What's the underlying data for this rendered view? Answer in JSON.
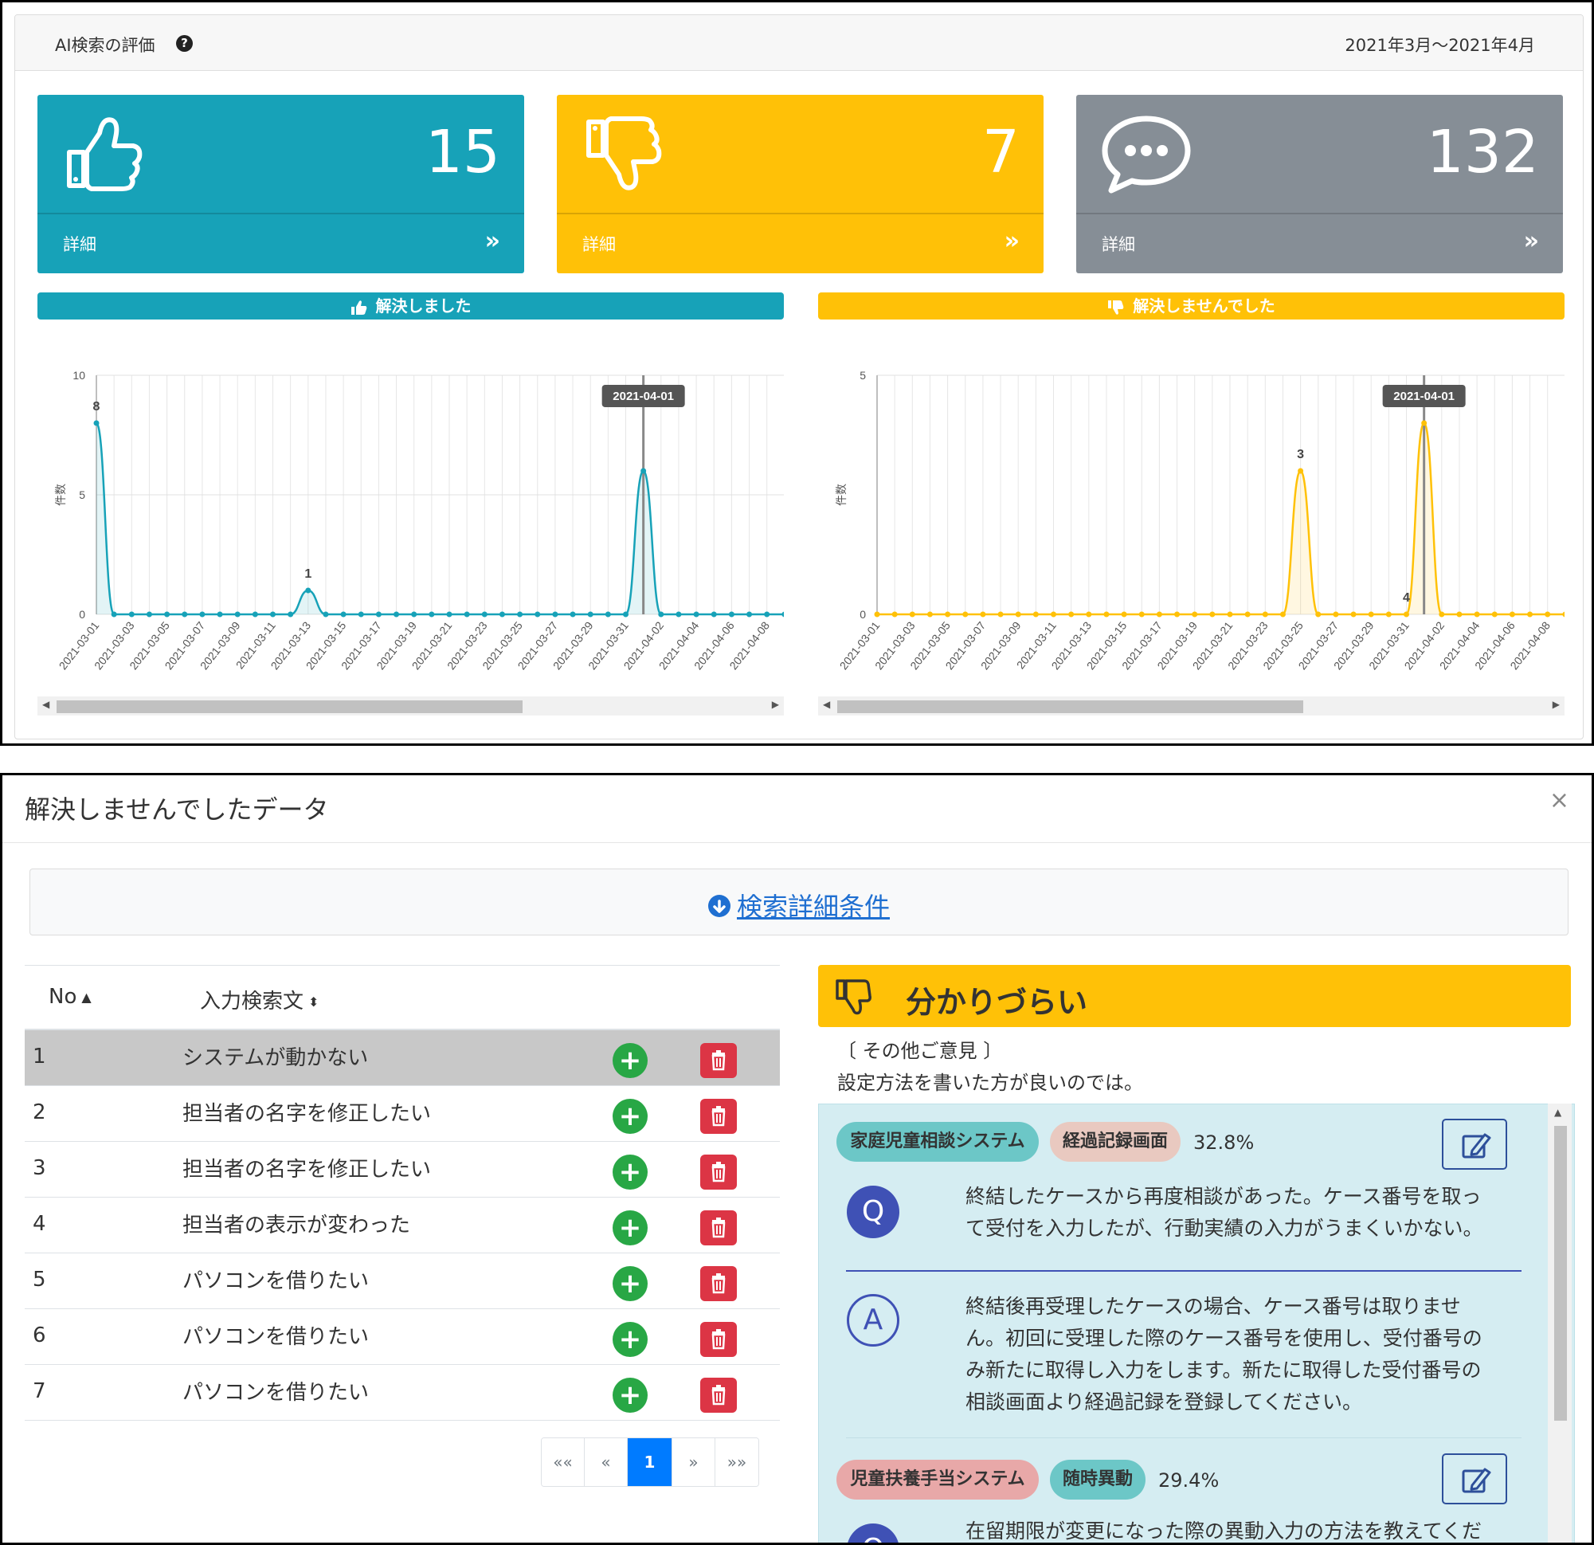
{
  "panel": {
    "title": "AI検索の評価",
    "date_range": "2021年3月～2021年4月"
  },
  "cards": [
    {
      "value": "15",
      "link": "詳細",
      "icon": "thumbs-up-icon",
      "color": "#17a2b8"
    },
    {
      "value": "7",
      "link": "詳細",
      "icon": "thumbs-down-icon",
      "color": "#ffc107"
    },
    {
      "value": "132",
      "link": "詳細",
      "icon": "comment-dots-icon",
      "color": "#868e96"
    }
  ],
  "charts": {
    "solved_label": "解決しました",
    "unsolved_label": "解決しませんでした",
    "ylabel": "件数",
    "tooltip": "2021-04-01"
  },
  "chart_data": [
    {
      "type": "area",
      "title": "解決しました",
      "ylabel": "件数",
      "ylim": [
        0,
        10
      ],
      "yticks": [
        0,
        5,
        10
      ],
      "color": "#17a2b8",
      "x": [
        "2021-03-01",
        "2021-03-02",
        "2021-03-03",
        "2021-03-04",
        "2021-03-05",
        "2021-03-06",
        "2021-03-07",
        "2021-03-08",
        "2021-03-09",
        "2021-03-10",
        "2021-03-11",
        "2021-03-12",
        "2021-03-13",
        "2021-03-14",
        "2021-03-15",
        "2021-03-16",
        "2021-03-17",
        "2021-03-18",
        "2021-03-19",
        "2021-03-20",
        "2021-03-21",
        "2021-03-22",
        "2021-03-23",
        "2021-03-24",
        "2021-03-25",
        "2021-03-26",
        "2021-03-27",
        "2021-03-28",
        "2021-03-29",
        "2021-03-30",
        "2021-03-31",
        "2021-04-01",
        "2021-04-02",
        "2021-04-03",
        "2021-04-04",
        "2021-04-05",
        "2021-04-06",
        "2021-04-07",
        "2021-04-08",
        "2021-04-09"
      ],
      "values": [
        8,
        0,
        0,
        0,
        0,
        0,
        0,
        0,
        0,
        0,
        0,
        0,
        1,
        0,
        0,
        0,
        0,
        0,
        0,
        0,
        0,
        0,
        0,
        0,
        0,
        0,
        0,
        0,
        0,
        0,
        0,
        6,
        0,
        0,
        0,
        0,
        0,
        0,
        0,
        0
      ],
      "labeled_points": [
        {
          "x": "2021-03-01",
          "label": "8"
        },
        {
          "x": "2021-03-13",
          "label": "1"
        }
      ],
      "highlight_x": "2021-04-01"
    },
    {
      "type": "area",
      "title": "解決しませんでした",
      "ylabel": "件数",
      "ylim": [
        0,
        5
      ],
      "yticks": [
        0,
        5
      ],
      "color": "#ffc107",
      "x": [
        "2021-03-01",
        "2021-03-02",
        "2021-03-03",
        "2021-03-04",
        "2021-03-05",
        "2021-03-06",
        "2021-03-07",
        "2021-03-08",
        "2021-03-09",
        "2021-03-10",
        "2021-03-11",
        "2021-03-12",
        "2021-03-13",
        "2021-03-14",
        "2021-03-15",
        "2021-03-16",
        "2021-03-17",
        "2021-03-18",
        "2021-03-19",
        "2021-03-20",
        "2021-03-21",
        "2021-03-22",
        "2021-03-23",
        "2021-03-24",
        "2021-03-25",
        "2021-03-26",
        "2021-03-27",
        "2021-03-28",
        "2021-03-29",
        "2021-03-30",
        "2021-03-31",
        "2021-04-01",
        "2021-04-02",
        "2021-04-03",
        "2021-04-04",
        "2021-04-05",
        "2021-04-06",
        "2021-04-07",
        "2021-04-08",
        "2021-04-09"
      ],
      "values": [
        0,
        0,
        0,
        0,
        0,
        0,
        0,
        0,
        0,
        0,
        0,
        0,
        0,
        0,
        0,
        0,
        0,
        0,
        0,
        0,
        0,
        0,
        0,
        0,
        3,
        0,
        0,
        0,
        0,
        0,
        0,
        4,
        0,
        0,
        0,
        0,
        0,
        0,
        0,
        0
      ],
      "labeled_points": [
        {
          "x": "2021-03-25",
          "label": "3"
        },
        {
          "x": "2021-03-31",
          "label": "4"
        }
      ],
      "highlight_x": "2021-04-01"
    }
  ],
  "modal": {
    "title": "解決しませんでしたデータ",
    "close": "×",
    "search_link": "検索詳細条件"
  },
  "table": {
    "col_no": "No",
    "col_query": "入力検索文",
    "rows": [
      {
        "no": "1",
        "text": "システムが動かない"
      },
      {
        "no": "2",
        "text": "担当者の名字を修正したい"
      },
      {
        "no": "3",
        "text": "担当者の名字を修正したい"
      },
      {
        "no": "4",
        "text": "担当者の表示が変わった"
      },
      {
        "no": "5",
        "text": "パソコンを借りたい"
      },
      {
        "no": "6",
        "text": "パソコンを借りたい"
      },
      {
        "no": "7",
        "text": "パソコンを借りたい"
      }
    ],
    "selected_index": 0
  },
  "pager": {
    "first": "««",
    "prev": "«",
    "current": "1",
    "next": "»",
    "last": "»»"
  },
  "detail": {
    "title": "分かりづらい",
    "opinion_label": "〔 その他ご意見 〕",
    "opinion_text": "設定方法を書いた方が良いのでは。",
    "answers": [
      {
        "system": "家庭児童相談システム",
        "screen": "経過記録画面",
        "score": "32.8%",
        "q": "Q",
        "question_line1": "終結したケースから再度相談があった。ケース番号を取っ",
        "question_line2": "て受付を入力したが、行動実績の入力がうまくいかない。",
        "a": "A",
        "answer_line1": "終結後再受理したケースの場合、ケース番号は取りませ",
        "answer_line2": "ん。初回に受理した際のケース番号を使用し、受付番号の",
        "answer_line3": "み新たに取得し入力をします。新たに取得した受付番号の",
        "answer_line4": "相談画面より経過記録を登録してください。"
      },
      {
        "system": "児童扶養手当システム",
        "screen": "随時異動",
        "score": "29.4%",
        "q": "Q",
        "question_line1": "在留期限が変更になった際の異動入力の方法を教えてくだ"
      }
    ]
  }
}
